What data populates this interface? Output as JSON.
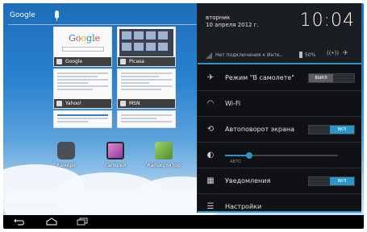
{
  "home": {
    "google_label": "Google",
    "thumbnails": [
      {
        "label": "Google"
      },
      {
        "label": "Picasa"
      },
      {
        "label": "Yahoo!"
      },
      {
        "label": "MSN"
      }
    ],
    "apps": [
      {
        "label": "Камера",
        "icon": "camera-icon",
        "color": "#4a4f58"
      },
      {
        "label": "Галерея",
        "icon": "gallery-icon",
        "color": "#c85fb6"
      },
      {
        "label": "Калькулятор",
        "icon": "calculator-icon",
        "color": "#7bb34a"
      }
    ]
  },
  "navbar": {
    "buttons": [
      {
        "icon": "back-icon"
      },
      {
        "icon": "home-icon"
      },
      {
        "icon": "recent-apps-icon"
      }
    ]
  },
  "panel": {
    "day": "вторник",
    "date": "10 апреля 2012 г.",
    "time": "10:04",
    "network_status": "Нет подключения к Инте..",
    "battery": "50%",
    "accent": "#2b95c8",
    "rows": [
      {
        "label": "Режим \"В самолете\"",
        "icon": "airplane-icon",
        "toggle": "ВЫКЛ",
        "state": "off"
      },
      {
        "label": "Wi-Fi",
        "icon": "wifi-icon"
      },
      {
        "label": "Автоповорот экрана",
        "icon": "rotate-icon",
        "toggle": "ВКЛ",
        "state": "on"
      },
      {
        "label": "",
        "icon": "brightness-icon",
        "slider": "АВТО"
      },
      {
        "label": "Уведомления",
        "icon": "notifications-icon",
        "toggle": "ВКЛ",
        "state": "on"
      },
      {
        "label": "Настройки",
        "icon": "settings-icon"
      }
    ]
  }
}
